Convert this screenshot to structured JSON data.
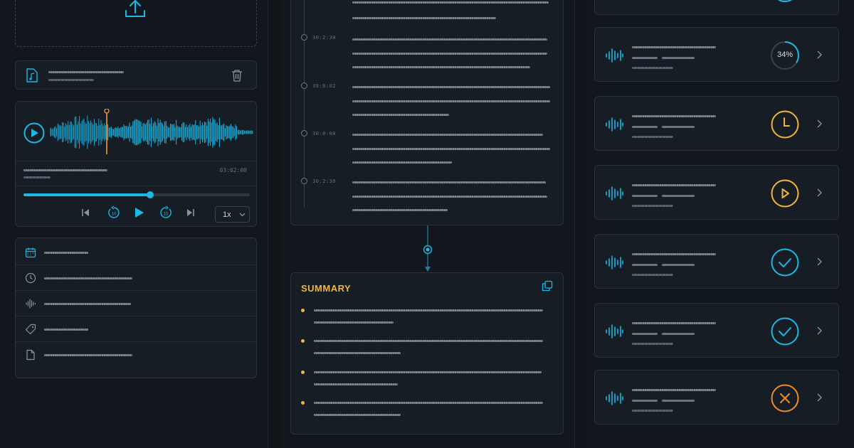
{
  "player": {
    "time": "03:02:00",
    "progress": 0.56,
    "speed": "1x"
  },
  "transcript": {
    "timestamps": [
      "30:2:30",
      "30:8:02",
      "30:0:00",
      "30:2:30"
    ]
  },
  "summary": {
    "title": "SUMMARY"
  },
  "jobs": [
    {
      "status": "in-progress",
      "percent": "34%"
    },
    {
      "status": "queued"
    },
    {
      "status": "ready-to-play"
    },
    {
      "status": "complete"
    },
    {
      "status": "complete"
    },
    {
      "status": "failed"
    }
  ],
  "colors": {
    "accent": "#1cb8e6",
    "amber": "#f2b53a",
    "orange": "#f08a2a",
    "playhead": "#f39a3c"
  }
}
